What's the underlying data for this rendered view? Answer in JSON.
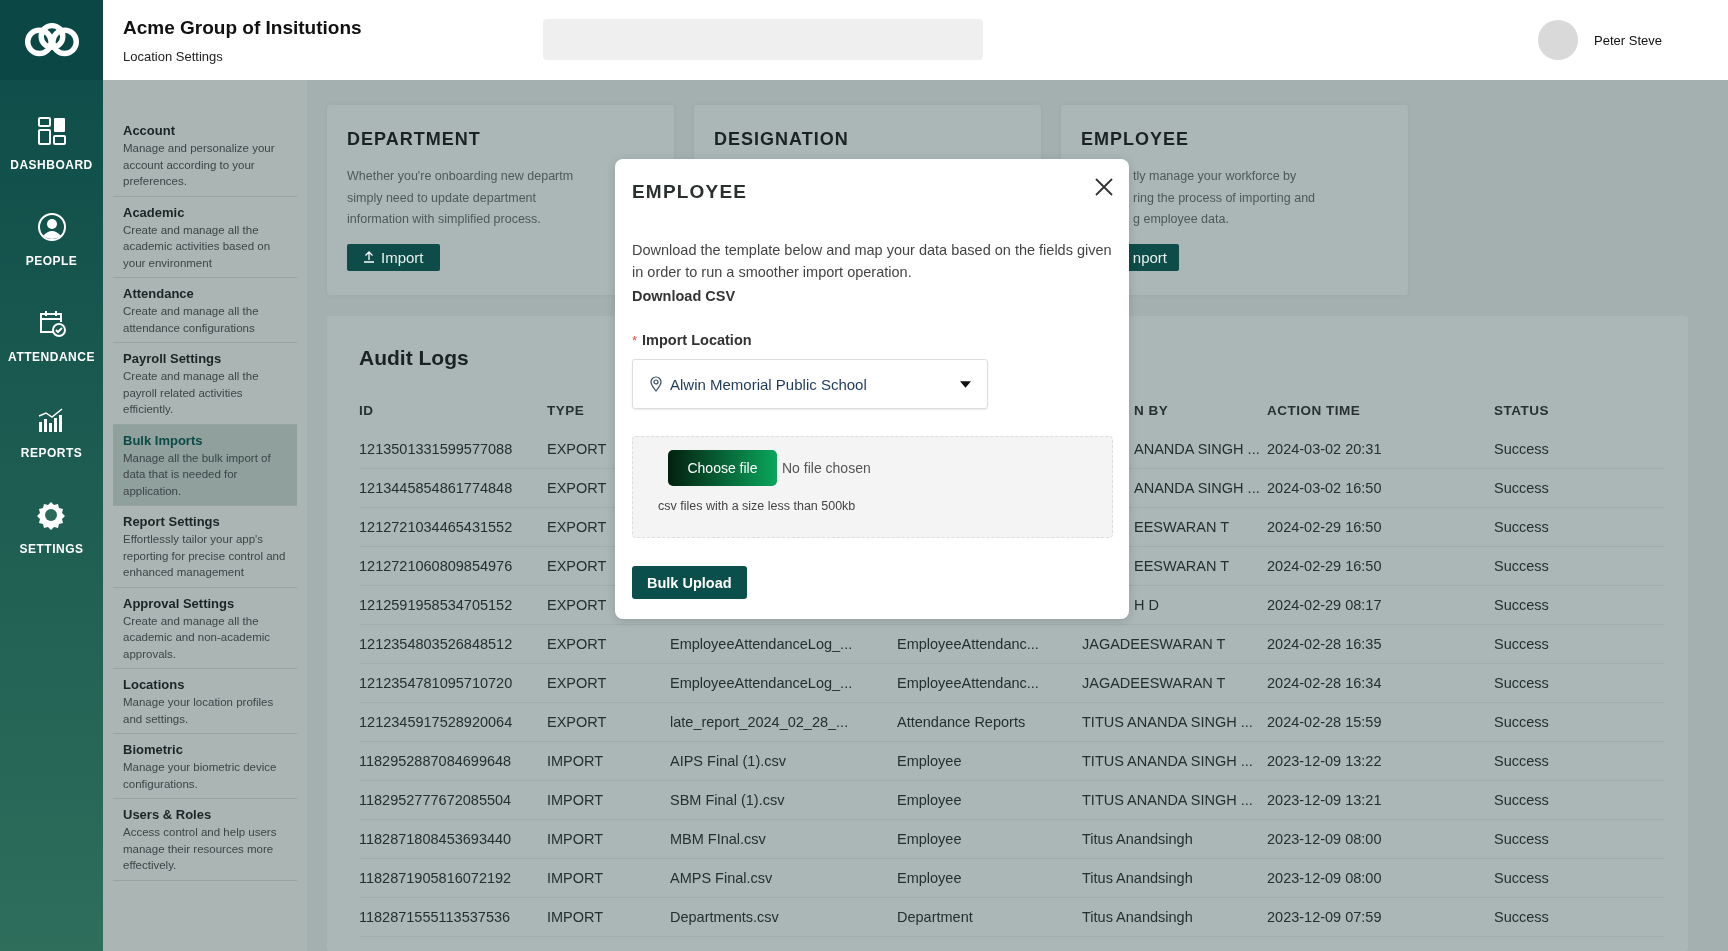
{
  "app": {
    "title": "Acme Group of Insitutions",
    "subtitle": "Location Settings",
    "user": "Peter Steve"
  },
  "nav": [
    {
      "label": "DASHBOARD",
      "kind": "dashboard"
    },
    {
      "label": "PEOPLE",
      "kind": "people"
    },
    {
      "label": "ATTENDANCE",
      "kind": "attendance"
    },
    {
      "label": "REPORTS",
      "kind": "reports"
    },
    {
      "label": "SETTINGS",
      "kind": "settings"
    }
  ],
  "settings": [
    {
      "title": "Account",
      "description": "Manage and personalize your account according to your preferences.",
      "selected": false
    },
    {
      "title": "Academic",
      "description": "Create and manage all the academic activities based on your environment",
      "selected": false
    },
    {
      "title": "Attendance",
      "description": "Create and manage all the attendance configurations",
      "selected": false
    },
    {
      "title": "Payroll Settings",
      "description": "Create and manage all the payroll related activities efficiently.",
      "selected": false
    },
    {
      "title": "Bulk Imports",
      "description": "Manage all the bulk import of data that is needed for application.",
      "selected": true
    },
    {
      "title": "Report Settings",
      "description": "Effortlessly tailor your app's reporting for precise control and enhanced management",
      "selected": false
    },
    {
      "title": "Approval Settings",
      "description": "Create and manage all the academic and non-academic approvals.",
      "selected": false
    },
    {
      "title": "Locations",
      "description": "Manage your location profiles and settings.",
      "selected": false
    },
    {
      "title": "Biometric",
      "description": "Manage your biometric device configurations.",
      "selected": false
    },
    {
      "title": "Users & Roles",
      "description": "Access control and help users manage their resources more effectively.",
      "selected": false
    }
  ],
  "cards": [
    {
      "title": "DEPARTMENT",
      "lines": [
        "Whether you're onboarding new departm",
        "simply need to update department",
        "information with simplified process."
      ],
      "button": "Import"
    },
    {
      "title": "DESIGNATION"
    },
    {
      "title": "EMPLOYEE",
      "lines": [
        "tly manage your workforce by",
        "ring the process of importing and",
        "g employee data."
      ],
      "button": "nport"
    }
  ],
  "audit": {
    "title": "Audit Logs",
    "columns": [
      "ID",
      "TYPE",
      "N BY",
      "ACTION TIME",
      "STATUS"
    ],
    "rows": [
      {
        "id": "1213501331599577088",
        "type": "EXPORT",
        "done_by": "ANANDA SINGH ...",
        "time": "2024-03-02 20:31",
        "status": "Success"
      },
      {
        "id": "1213445854861774848",
        "type": "EXPORT",
        "done_by": "ANANDA SINGH ...",
        "time": "2024-03-02 16:50",
        "status": "Success"
      },
      {
        "id": "1212721034465431552",
        "type": "EXPORT",
        "done_by": "EESWARAN T",
        "time": "2024-02-29 16:50",
        "status": "Success"
      },
      {
        "id": "1212721060809854976",
        "type": "EXPORT",
        "done_by": "EESWARAN T",
        "time": "2024-02-29 16:50",
        "status": "Success"
      },
      {
        "id": "1212591958534705152",
        "type": "EXPORT",
        "done_by": "H D",
        "time": "2024-02-29 08:17",
        "status": "Success"
      },
      {
        "id": "1212354803526848512",
        "type": "EXPORT",
        "file": "EmployeeAttendanceLog_...",
        "module": "EmployeeAttendanc...",
        "done_by": "JAGADEESWARAN T",
        "time": "2024-02-28 16:35",
        "status": "Success"
      },
      {
        "id": "1212354781095710720",
        "type": "EXPORT",
        "file": "EmployeeAttendanceLog_...",
        "module": "EmployeeAttendanc...",
        "done_by": "JAGADEESWARAN T",
        "time": "2024-02-28 16:34",
        "status": "Success"
      },
      {
        "id": "1212345917528920064",
        "type": "EXPORT",
        "file": "late_report_2024_02_28_...",
        "module": "Attendance Reports",
        "done_by": "TITUS ANANDA SINGH ...",
        "time": "2024-02-28 15:59",
        "status": "Success"
      },
      {
        "id": "1182952887084699648",
        "type": "IMPORT",
        "file": "AIPS Final (1).csv",
        "module": "Employee",
        "done_by": "TITUS ANANDA SINGH ...",
        "time": "2023-12-09 13:22",
        "status": "Success"
      },
      {
        "id": "1182952777672085504",
        "type": "IMPORT",
        "file": "SBM Final (1).csv",
        "module": "Employee",
        "done_by": "TITUS ANANDA SINGH ...",
        "time": "2023-12-09 13:21",
        "status": "Success"
      },
      {
        "id": "1182871808453693440",
        "type": "IMPORT",
        "file": "MBM FInal.csv",
        "module": "Employee",
        "done_by": "Titus Anandsingh",
        "time": "2023-12-09 08:00",
        "status": "Success"
      },
      {
        "id": "1182871905816072192",
        "type": "IMPORT",
        "file": "AMPS Final.csv",
        "module": "Employee",
        "done_by": "Titus Anandsingh",
        "time": "2023-12-09 08:00",
        "status": "Success"
      },
      {
        "id": "1182871555113537536",
        "type": "IMPORT",
        "file": "Departments.csv",
        "module": "Department",
        "done_by": "Titus Anandsingh",
        "time": "2023-12-09 07:59",
        "status": "Success"
      }
    ]
  },
  "modal": {
    "title": "EMPLOYEE",
    "description": "Download the template below and map your data based on the fields given in order to run a smoother import operation.",
    "download_link": "Download CSV",
    "required_mark": "*",
    "field_label": "Import Location",
    "location": "Alwin Memorial Public School",
    "file_button": "Choose file",
    "file_status": "No file chosen",
    "hint": "csv files with a size less than 500kb",
    "submit": "Bulk Upload"
  }
}
